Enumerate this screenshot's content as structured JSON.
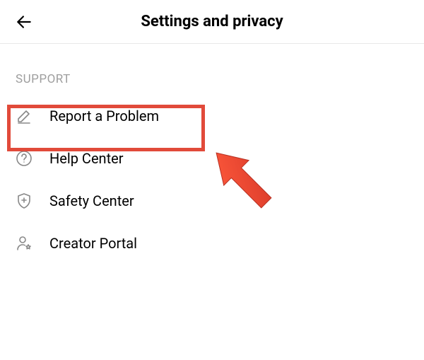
{
  "header": {
    "title": "Settings and privacy"
  },
  "section": {
    "label": "SUPPORT"
  },
  "items": [
    {
      "label": "Report a Problem"
    },
    {
      "label": "Help Center"
    },
    {
      "label": "Safety Center"
    },
    {
      "label": "Creator Portal"
    }
  ]
}
